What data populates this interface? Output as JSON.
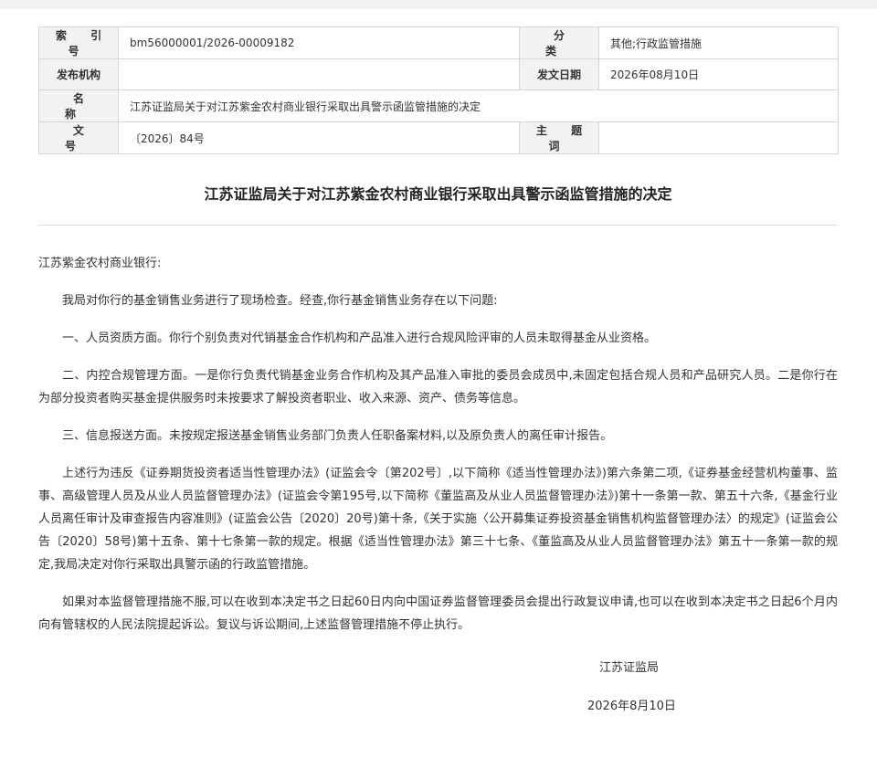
{
  "meta_table": {
    "index_label": "索 引 号",
    "index_value": "bm56000001/2026-00009182",
    "category_label": "分 类",
    "category_value": "其他;行政监管措施",
    "publisher_label": "发布机构",
    "publisher_value": "",
    "date_label": "发文日期",
    "date_value": "2026年08月10日",
    "name_label": "名 称",
    "name_value": "江苏证监局关于对江苏紫金农村商业银行采取出具警示函监管措施的决定",
    "docno_label": "文 号",
    "docno_value": "〔2026〕84号",
    "keywords_label": "主 题 词",
    "keywords_value": ""
  },
  "document": {
    "title": "江苏证监局关于对江苏紫金农村商业银行采取出具警示函监管措施的决定",
    "salutation": "江苏紫金农村商业银行:",
    "paragraphs": [
      "我局对你行的基金销售业务进行了现场检查。经查,你行基金销售业务存在以下问题:",
      "一、人员资质方面。你行个别负责对代销基金合作机构和产品准入进行合规风险评审的人员未取得基金从业资格。",
      "二、内控合规管理方面。一是你行负责代销基金业务合作机构及其产品准入审批的委员会成员中,未固定包括合规人员和产品研究人员。二是你行在为部分投资者购买基金提供服务时未按要求了解投资者职业、收入来源、资产、债务等信息。",
      "三、信息报送方面。未按规定报送基金销售业务部门负责人任职备案材料,以及原负责人的离任审计报告。",
      "上述行为违反《证券期货投资者适当性管理办法》(证监会令〔第202号〕,以下简称《适当性管理办法》)第六条第二项,《证券基金经营机构董事、监事、高级管理人员及从业人员监督管理办法》(证监会令第195号,以下简称《董监高及从业人员监督管理办法》)第十一条第一款、第五十六条,《基金行业人员离任审计及审查报告内容准则》(证监会公告〔2020〕20号)第十条,《关于实施〈公开募集证券投资基金销售机构监督管理办法〉的规定》(证监会公告〔2020〕58号)第十五条、第十七条第一款的规定。根据《适当性管理办法》第三十七条、《董监高及从业人员监督管理办法》第五十一条第一款的规定,我局决定对你行采取出具警示函的行政监管措施。",
      "如果对本监督管理措施不服,可以在收到本决定书之日起60日内向中国证券监督管理委员会提出行政复议申请,也可以在收到本决定书之日起6个月内向有管辖权的人民法院提起诉讼。复议与诉讼期间,上述监督管理措施不停止执行。"
    ],
    "signature": "江苏证监局",
    "sign_date": "2026年8月10日"
  }
}
